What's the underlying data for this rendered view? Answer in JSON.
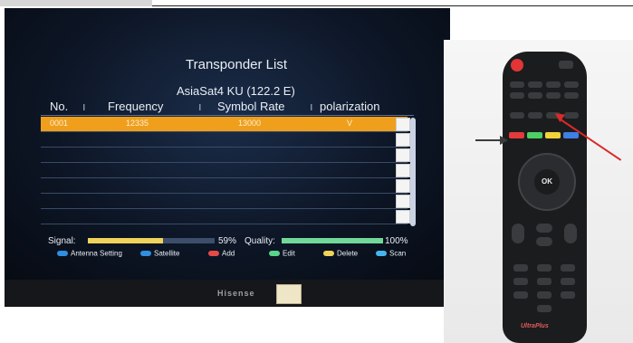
{
  "tv_screen": {
    "title": "Transponder List",
    "satellite": "AsiaSat4 KU (122.2 E)",
    "columns": [
      "No.",
      "Frequency",
      "Symbol Rate",
      "polarization"
    ],
    "rows": [
      {
        "no": "0001",
        "frequency": "12335",
        "symbol_rate": "13000",
        "polarization": "V",
        "selected": true
      }
    ],
    "signal": {
      "label": "Signal:",
      "percent_text": "59%",
      "fraction": 0.59,
      "color": "#f0d35a"
    },
    "quality": {
      "label": "Quality:",
      "percent_text": "100%",
      "fraction": 1.0,
      "color": "#71d89a"
    },
    "legend": [
      {
        "label": "Antenna Setting",
        "color": "#2f8fe0"
      },
      {
        "label": "Satellite",
        "color": "#2f8fe0"
      },
      {
        "label": "Add",
        "color": "#e84848"
      },
      {
        "label": "Edit",
        "color": "#58d38a"
      },
      {
        "label": "Delete",
        "color": "#f0d35a"
      },
      {
        "label": "Scan",
        "color": "#46b4f0"
      }
    ],
    "tv_brand": "Hisense"
  },
  "remote": {
    "ok_label": "OK",
    "brand": "UltraPlus",
    "color_buttons": [
      "#e33a3a",
      "#4ccf64",
      "#f1d33a",
      "#3f7fe6"
    ]
  },
  "colors": {
    "selected_row": "#ef9f1b",
    "annotation_arrow": "#d92a2a"
  }
}
